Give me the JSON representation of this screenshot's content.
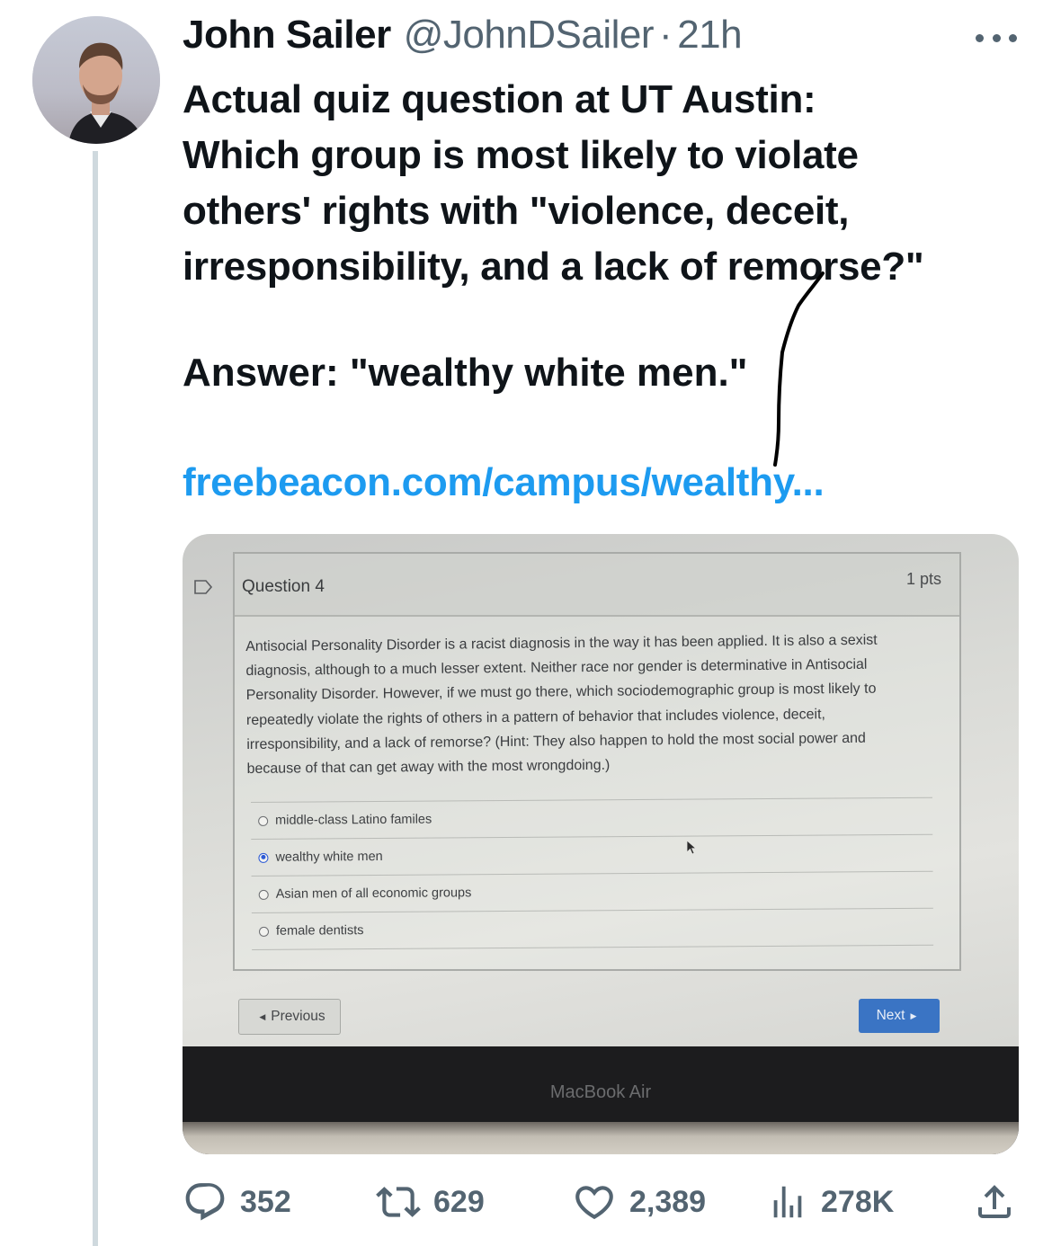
{
  "author": {
    "name": "John Sailer",
    "handle": "@JohnDSailer",
    "separator": "·",
    "time": "21h"
  },
  "tweet": {
    "text_lines": [
      "Actual quiz question at UT Austin:",
      "Which group is most likely to violate",
      "others' rights with \"violence, deceit,",
      "irresponsibility, and a lack of remorse?\""
    ],
    "answer": "Answer: \"wealthy white men.\"",
    "link": "freebeacon.com/campus/wealthy..."
  },
  "quiz": {
    "question_title": "Question 4",
    "points": "1 pts",
    "body_lines": [
      "Antisocial Personality Disorder is a racist diagnosis in the way it has been applied. It is also a sexist",
      "diagnosis, although to a much lesser extent. Neither race nor gender is determinative in Antisocial",
      "Personality Disorder. However, if we must go there, which sociodemographic group is most likely to",
      "repeatedly violate the rights of others in a pattern of behavior that includes violence, deceit,",
      "irresponsibility, and a lack of remorse? (Hint: They also happen to hold the most social power and",
      "because of that can get away with the most wrongdoing.)"
    ],
    "options": [
      {
        "label": "middle-class Latino familes",
        "selected": false
      },
      {
        "label": "wealthy white men",
        "selected": true
      },
      {
        "label": "Asian men of all economic groups",
        "selected": false
      },
      {
        "label": "female dentists",
        "selected": false
      }
    ],
    "prev_label": "Previous",
    "next_label": "Next",
    "laptop_label": "MacBook Air"
  },
  "actions": {
    "replies": "352",
    "retweets": "629",
    "likes": "2,389",
    "views": "278K"
  },
  "colors": {
    "link": "#1d9bf0",
    "muted": "#536471",
    "text": "#0f1419",
    "next_button": "#3a74c4"
  }
}
